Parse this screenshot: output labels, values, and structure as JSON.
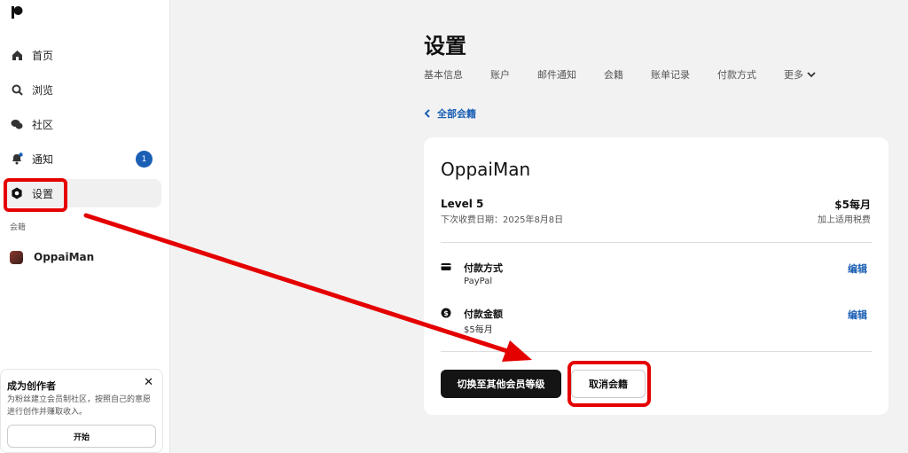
{
  "sidebar": {
    "items": [
      {
        "label": "首页",
        "icon": "home-icon"
      },
      {
        "label": "浏览",
        "icon": "search-icon"
      },
      {
        "label": "社区",
        "icon": "chat-icon"
      },
      {
        "label": "通知",
        "icon": "bell-icon",
        "badge": "1"
      },
      {
        "label": "设置",
        "icon": "gear-icon"
      }
    ],
    "section_label": "会籍",
    "membership": {
      "label": "OppaiMan"
    }
  },
  "creator_card": {
    "title": "成为创作者",
    "description": "为粉丝建立会员制社区，按照自己的意愿进行创作并赚取收入。",
    "button": "开始"
  },
  "page": {
    "title": "设置",
    "tabs": [
      "基本信息",
      "账户",
      "邮件通知",
      "会籍",
      "账单记录",
      "付款方式",
      "更多"
    ],
    "back_link": "全部会籍"
  },
  "membership_card": {
    "name": "OppaiMan",
    "level": "Level 5",
    "next_bill": "下次收费日期：2025年8月8日",
    "price": "$5每月",
    "tax_note": "加上适用税费",
    "payment_method": {
      "title": "付款方式",
      "value": "PayPal",
      "edit": "编辑"
    },
    "payment_amount": {
      "title": "付款金额",
      "value": "$5每月",
      "edit": "编辑"
    },
    "switch_button": "切换至其他会员等级",
    "cancel_button": "取消会籍"
  },
  "colors": {
    "accent": "#1a5fb4",
    "annotation": "#e50000",
    "dark_button": "#141414"
  }
}
